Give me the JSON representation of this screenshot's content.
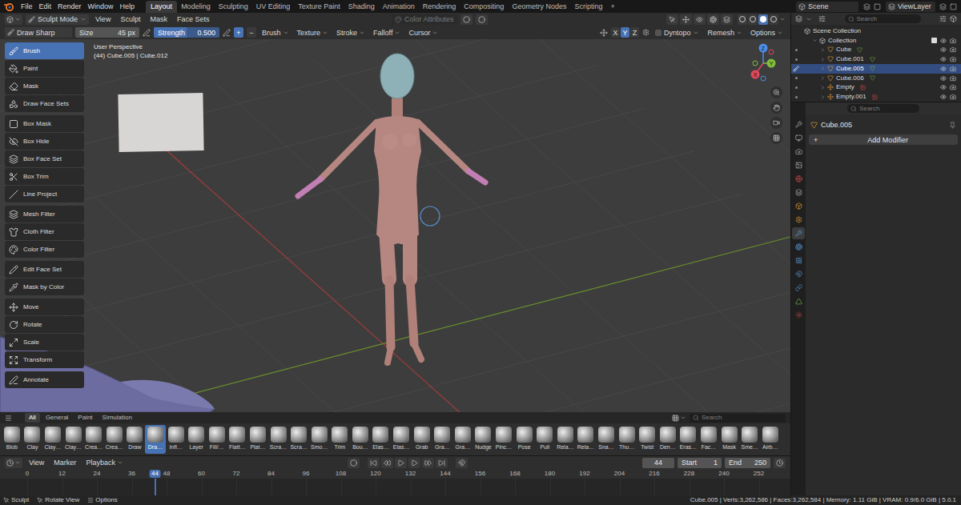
{
  "topbar": {
    "menus": [
      "File",
      "Edit",
      "Render",
      "Window",
      "Help"
    ],
    "workspaces": [
      {
        "label": "Layout",
        "selected": true
      },
      {
        "label": "Modeling",
        "selected": false
      },
      {
        "label": "Sculpting",
        "selected": false
      },
      {
        "label": "UV Editing",
        "selected": false
      },
      {
        "label": "Texture Paint",
        "selected": false
      },
      {
        "label": "Shading",
        "selected": false
      },
      {
        "label": "Animation",
        "selected": false
      },
      {
        "label": "Rendering",
        "selected": false
      },
      {
        "label": "Compositing",
        "selected": false
      },
      {
        "label": "Geometry Nodes",
        "selected": false
      },
      {
        "label": "Scripting",
        "selected": false
      }
    ],
    "add_workspace": "+",
    "scene": "Scene",
    "view_layer": "ViewLayer"
  },
  "viewport_header": {
    "mode": "Sculpt Mode",
    "menus": [
      "View",
      "Sculpt",
      "Mask",
      "Face Sets"
    ],
    "color_attributes": {
      "label": "Color Attributes",
      "disabled": true
    },
    "shading": [
      {
        "selected": false
      },
      {
        "selected": false
      },
      {
        "selected": true
      },
      {
        "selected": false
      }
    ]
  },
  "tool_settings": {
    "brush": "Draw Sharp",
    "size": {
      "label": "Size",
      "value": "45 px"
    },
    "strength": {
      "label": "Strength",
      "value": "0.500",
      "level": 0.5
    },
    "add": "+",
    "subtract": "−",
    "menus": [
      "Brush",
      "Texture",
      "Stroke",
      "Falloff",
      "Cursor"
    ],
    "symmetry": [
      {
        "label": "X",
        "on": false
      },
      {
        "label": "Y",
        "on": true
      },
      {
        "label": "Z",
        "on": false
      }
    ],
    "dyntopo": {
      "label": "Dyntopo",
      "checked": false
    },
    "right_menus": [
      "Remesh",
      "Options"
    ]
  },
  "toolbar": [
    [
      {
        "label": "Brush",
        "selected": true
      },
      {
        "label": "Paint",
        "selected": false
      },
      {
        "label": "Mask",
        "selected": false
      },
      {
        "label": "Draw Face Sets",
        "selected": false
      }
    ],
    [
      {
        "label": "Box Mask",
        "selected": false
      },
      {
        "label": "Box Hide",
        "selected": false
      },
      {
        "label": "Box Face Set",
        "selected": false
      },
      {
        "label": "Box Trim",
        "selected": false
      },
      {
        "label": "Line Project",
        "selected": false
      }
    ],
    [
      {
        "label": "Mesh Filter",
        "selected": false
      },
      {
        "label": "Cloth Filter",
        "selected": false
      },
      {
        "label": "Color Filter",
        "selected": false
      }
    ],
    [
      {
        "label": "Edit Face Set",
        "selected": false
      },
      {
        "label": "Mask by Color",
        "selected": false
      }
    ],
    [
      {
        "label": "Move",
        "selected": false
      },
      {
        "label": "Rotate",
        "selected": false
      },
      {
        "label": "Scale",
        "selected": false
      },
      {
        "label": "Transform",
        "selected": false
      }
    ],
    [
      {
        "label": "Annotate",
        "selected": false
      }
    ]
  ],
  "viewport": {
    "view_name": "User Perspective",
    "object_info": "(44) Cube.005 | Cube.012",
    "gizmo_axes": [
      {
        "label": "X",
        "color": "#e0485a"
      },
      {
        "label": "Y",
        "color": "#82bd3c"
      },
      {
        "label": "Z",
        "color": "#4d8ee8"
      }
    ]
  },
  "asset_shelf": {
    "tabs": [
      {
        "label": "All",
        "selected": true
      },
      {
        "label": "General",
        "selected": false
      },
      {
        "label": "Paint",
        "selected": false
      },
      {
        "label": "Simulation",
        "selected": false
      }
    ],
    "search_placeholder": "Search",
    "brushes": [
      {
        "label": "Blob",
        "selected": false
      },
      {
        "label": "Clay",
        "selected": false
      },
      {
        "label": "Clay…",
        "selected": false
      },
      {
        "label": "Clay…",
        "selected": false
      },
      {
        "label": "Crea…",
        "selected": false
      },
      {
        "label": "Crea…",
        "selected": false
      },
      {
        "label": "Draw",
        "selected": false
      },
      {
        "label": "Dra…",
        "selected": true
      },
      {
        "label": "Infl…",
        "selected": false
      },
      {
        "label": "Layer",
        "selected": false
      },
      {
        "label": "Fill/…",
        "selected": false
      },
      {
        "label": "Flatt…",
        "selected": false
      },
      {
        "label": "Plat…",
        "selected": false
      },
      {
        "label": "Scra…",
        "selected": false
      },
      {
        "label": "Scra…",
        "selected": false
      },
      {
        "label": "Smo…",
        "selected": false
      },
      {
        "label": "Trim",
        "selected": false
      },
      {
        "label": "Bou…",
        "selected": false
      },
      {
        "label": "Elas…",
        "selected": false
      },
      {
        "label": "Elas…",
        "selected": false
      },
      {
        "label": "Grab",
        "selected": false
      },
      {
        "label": "Gra…",
        "selected": false
      },
      {
        "label": "Gra…",
        "selected": false
      },
      {
        "label": "Nudge",
        "selected": false
      },
      {
        "label": "Pinc…",
        "selected": false
      },
      {
        "label": "Pose",
        "selected": false
      },
      {
        "label": "Pull",
        "selected": false
      },
      {
        "label": "Rela…",
        "selected": false
      },
      {
        "label": "Rela…",
        "selected": false
      },
      {
        "label": "Sna…",
        "selected": false
      },
      {
        "label": "Thu…",
        "selected": false
      },
      {
        "label": "Twist",
        "selected": false
      },
      {
        "label": "Den…",
        "selected": false
      },
      {
        "label": "Eras…",
        "selected": false
      },
      {
        "label": "Fac…",
        "selected": false
      },
      {
        "label": "Mask",
        "selected": false
      },
      {
        "label": "Sme…",
        "selected": false
      },
      {
        "label": "Airb…",
        "selected": false
      }
    ]
  },
  "timeline": {
    "menus": [
      "View",
      "Marker",
      "Playback"
    ],
    "current_frame": "44",
    "start_label": "Start",
    "start": "1",
    "end_label": "End",
    "end": "250",
    "ticks": [
      "0",
      "12",
      "24",
      "36",
      "48",
      "60",
      "72",
      "84",
      "96",
      "108",
      "120",
      "132",
      "144",
      "156",
      "168",
      "180",
      "192",
      "204",
      "216",
      "228",
      "240",
      "252"
    ],
    "playhead": "44"
  },
  "outliner": {
    "search_placeholder": "Search",
    "items": [
      {
        "label": "Scene Collection",
        "kind": "scene_collection",
        "depth": 0,
        "expanded": true,
        "selected": false
      },
      {
        "label": "Collection",
        "kind": "collection",
        "depth": 1,
        "expanded": true,
        "selected": false,
        "checked": true,
        "visible": true
      },
      {
        "label": "Cube",
        "kind": "mesh",
        "depth": 2,
        "expanded": false,
        "selected": false,
        "visible": true
      },
      {
        "label": "Cube.001",
        "kind": "mesh",
        "depth": 2,
        "expanded": false,
        "selected": false,
        "visible": true
      },
      {
        "label": "Cube.005",
        "kind": "mesh",
        "depth": 2,
        "expanded": false,
        "selected": true,
        "visible": true
      },
      {
        "label": "Cube.006",
        "kind": "mesh",
        "depth": 2,
        "expanded": false,
        "selected": false,
        "visible": true
      },
      {
        "label": "Empty",
        "kind": "empty",
        "depth": 2,
        "expanded": false,
        "selected": false,
        "visible": true
      },
      {
        "label": "Empty.001",
        "kind": "empty",
        "depth": 2,
        "expanded": false,
        "selected": false,
        "visible": true
      }
    ]
  },
  "properties": {
    "search_placeholder": "Search",
    "object": "Cube.005",
    "add_icon": "+",
    "add_modifier": "Add Modifier",
    "tabs": [
      {
        "selected": false
      },
      {
        "selected": false
      },
      {
        "selected": false
      },
      {
        "selected": false
      },
      {
        "selected": false
      },
      {
        "selected": false
      },
      {
        "selected": false
      },
      {
        "selected": false
      },
      {
        "selected": true
      },
      {
        "selected": false
      },
      {
        "selected": false
      },
      {
        "selected": false
      },
      {
        "selected": false
      },
      {
        "selected": false
      },
      {
        "selected": false
      }
    ]
  },
  "status_bar": {
    "actions": [
      "Sculpt",
      "Rotate View",
      "Options"
    ],
    "info": "Cube.005 | Verts:3,262,586 | Faces:3,262,584 | Memory: 1.11 GiB | VRAM: 0.9/6.0 GiB | 5.0.1"
  }
}
